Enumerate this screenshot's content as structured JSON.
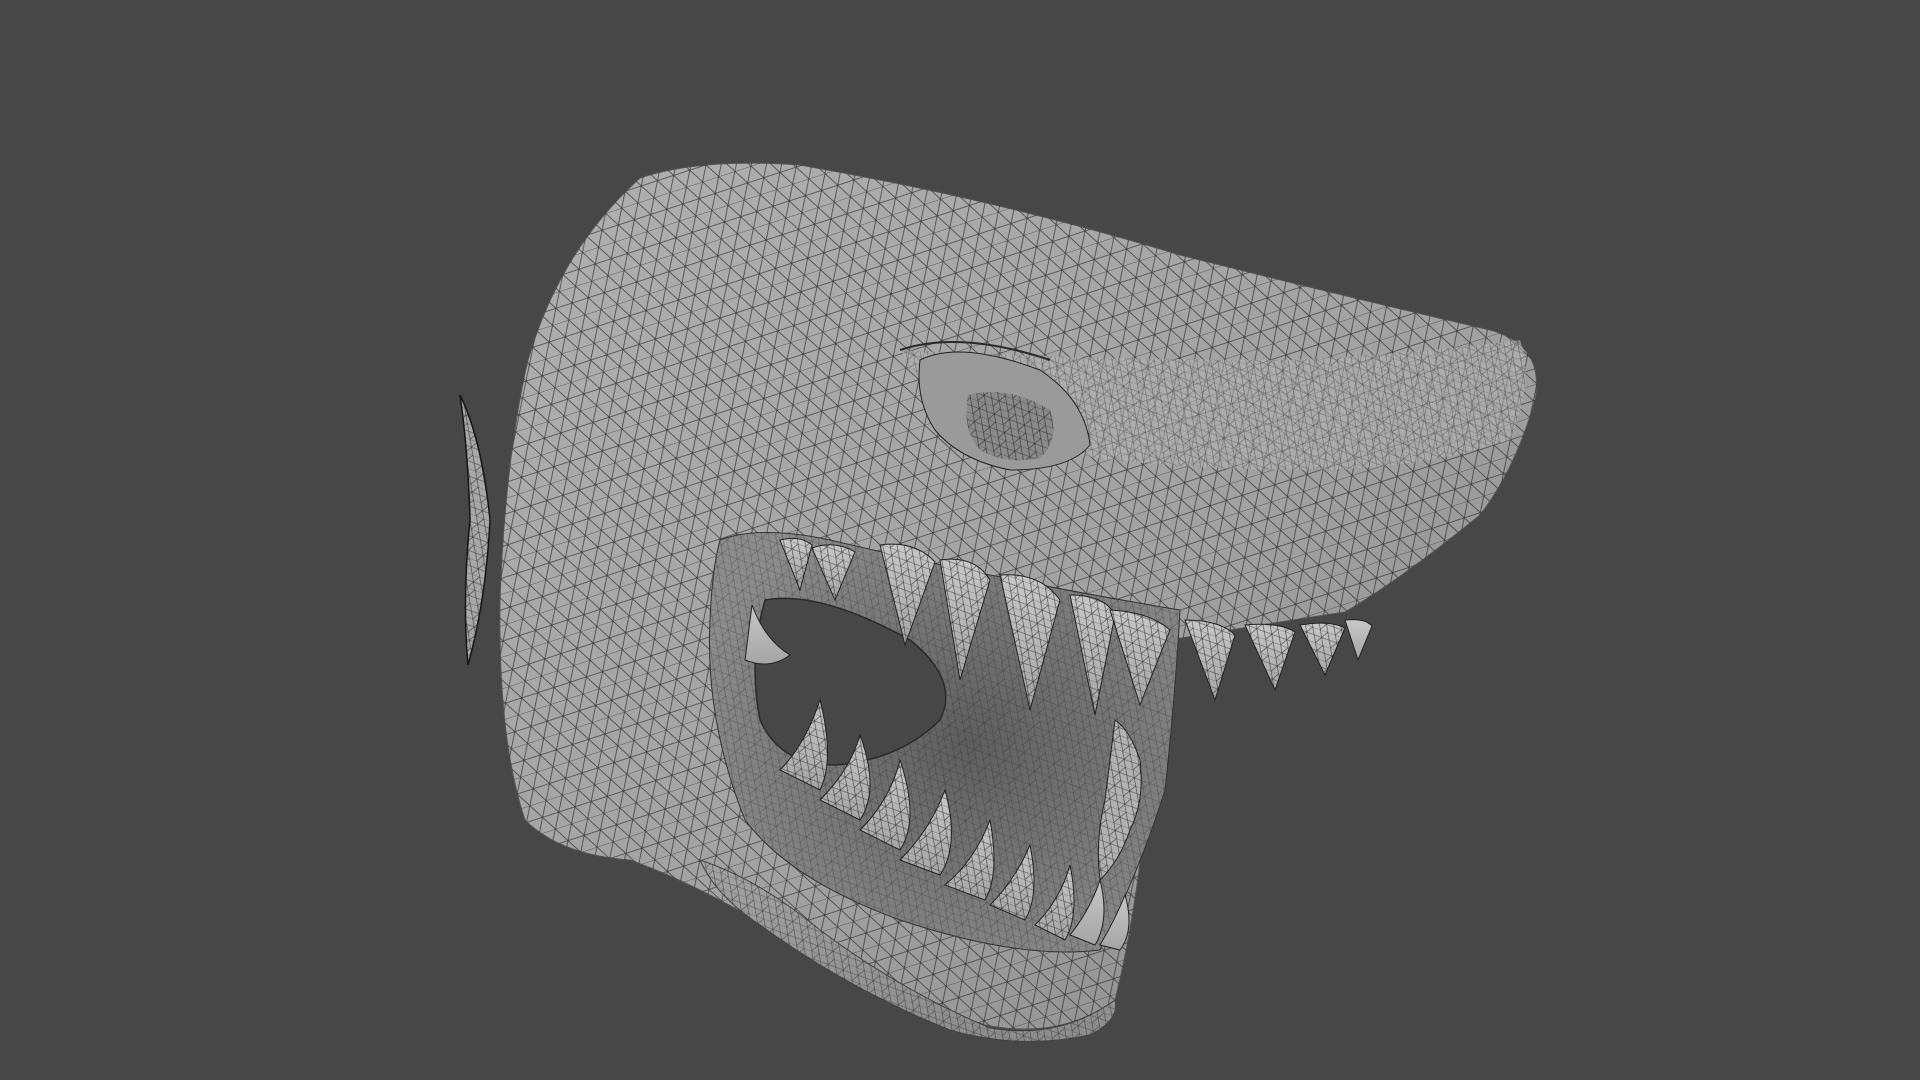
{
  "scene": {
    "background_color": "#474747",
    "subject": "shark-head-mesh",
    "display_mode": "wireframe-overlay",
    "mesh_color": "#9f9f9f",
    "wire_color": "#1b1b1b",
    "mouth_interior_color": "#6a6a6a",
    "tooth_color": "#b9b9b9"
  }
}
